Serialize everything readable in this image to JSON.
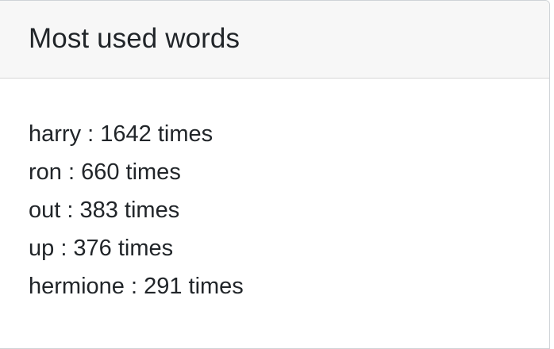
{
  "card": {
    "title": "Most used words"
  },
  "words": [
    "harry : 1642 times",
    "ron : 660 times",
    "out : 383 times",
    "up : 376 times",
    "hermione : 291 times"
  ]
}
